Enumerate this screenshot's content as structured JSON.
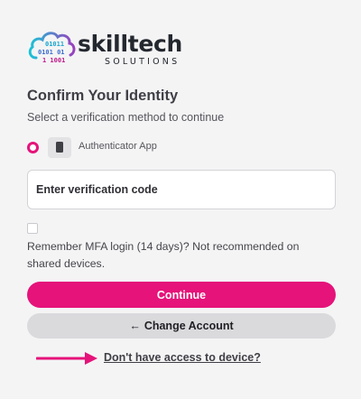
{
  "logo": {
    "name": "skilltech",
    "subtitle": "SOLUTIONS",
    "binary_rows": [
      "01011",
      "0101 01",
      "1 1001"
    ],
    "cloud_icon": "cloud-binary-icon"
  },
  "header": {
    "title": "Confirm Your Identity",
    "subtitle": "Select a verification method to continue"
  },
  "method": {
    "label": "Authenticator App",
    "icon": "smartphone-icon",
    "selected": true
  },
  "code_field": {
    "placeholder": "Enter verification code",
    "value": ""
  },
  "remember": {
    "checked": false,
    "label": "Remember MFA login (14 days)? Not recommended on shared devices."
  },
  "buttons": {
    "continue_label": "Continue",
    "change_account_label": "Change Account",
    "change_account_icon": "←"
  },
  "link": {
    "no_access_label": "Don't have access to device?",
    "pointer_icon": "arrow-right-icon"
  },
  "colors": {
    "accent": "#e5137a",
    "secondary_button": "#dadadd",
    "background": "#f4f4f5"
  }
}
